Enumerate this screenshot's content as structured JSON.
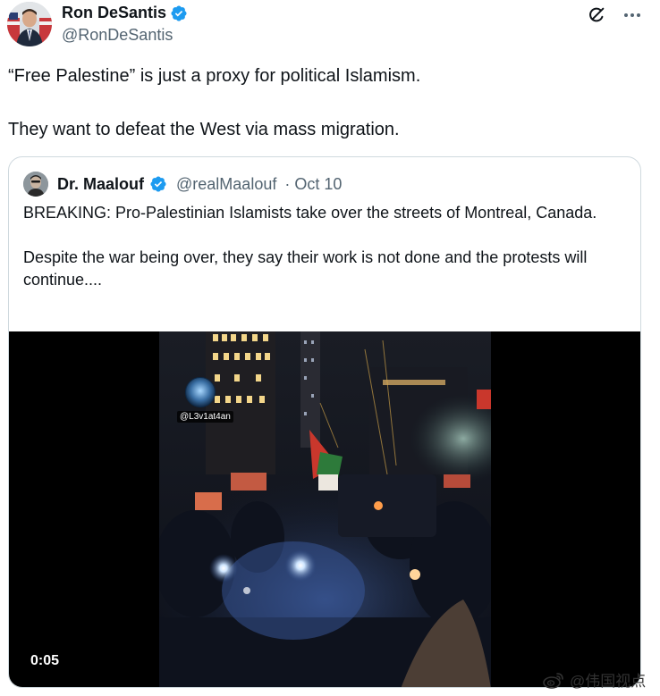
{
  "author": {
    "name": "Ron DeSantis",
    "handle": "@RonDeSantis",
    "avatar_icon": "user-avatar",
    "verified_icon": "verified-badge-icon"
  },
  "actions": {
    "grok_icon": "grok-icon",
    "more_icon": "more-options-icon"
  },
  "tweet": {
    "line1": "“Free Palestine” is just a proxy for political Islamism.",
    "line2": "They want to defeat the West via mass migration."
  },
  "quote": {
    "name": "Dr. Maalouf",
    "handle": "@realMaalouf",
    "date": "· Oct 10",
    "text1": "BREAKING: Pro-Palestinian Islamists take over the streets of Montreal, Canada.",
    "text2": "Despite the war being over, they say their work is not done and the protests will continue...."
  },
  "video": {
    "watermark_handle": "@L3v1at4an",
    "duration": "0:05"
  },
  "weibo_watermark": "@伟国视点",
  "colors": {
    "verified_blue": "#1d9bf0",
    "text_primary": "#0f1419",
    "text_secondary": "#536471",
    "border": "#cfd9de"
  }
}
